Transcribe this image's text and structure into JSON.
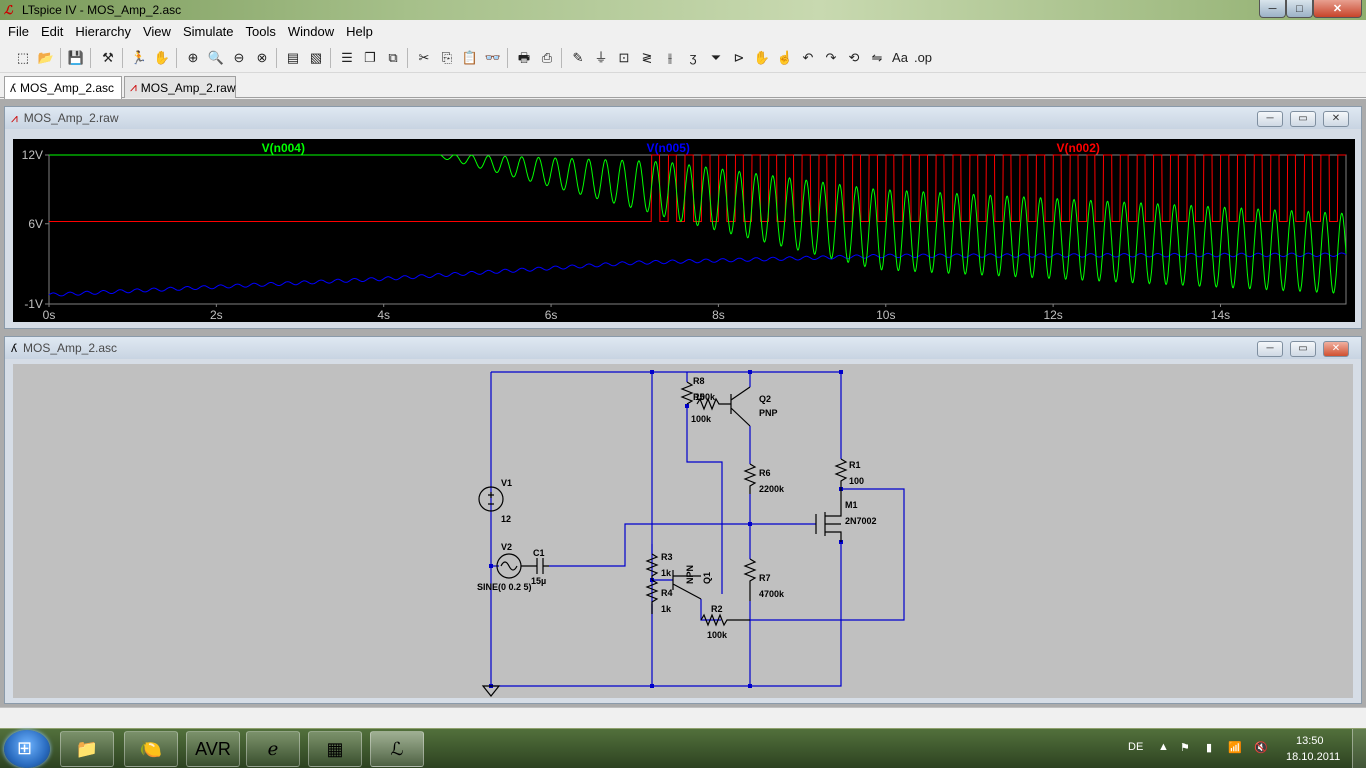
{
  "app": {
    "title": "LTspice IV - MOS_Amp_2.asc"
  },
  "window_buttons": {
    "minimize": "─",
    "maximize": "□",
    "close": "✕"
  },
  "menu": [
    "File",
    "Edit",
    "Hierarchy",
    "View",
    "Simulate",
    "Tools",
    "Window",
    "Help"
  ],
  "toolbar": {
    "icons": [
      "new-schematic-icon",
      "open-icon",
      "save-icon",
      "control-panel-icon",
      "run-icon",
      "halt-icon",
      "zoom-in-icon",
      "zoom-pan-icon",
      "zoom-out-icon",
      "zoom-cancel-icon",
      "autorange-icon",
      "delete-trace-icon",
      "tile-horizontal-icon",
      "cascade-icon",
      "close-all-icon",
      "cut-icon",
      "copy-icon",
      "paste-icon",
      "find-icon",
      "print-preview-icon",
      "print-icon",
      "wire-icon",
      "ground-icon",
      "label-icon",
      "resistor-icon",
      "capacitor-icon",
      "inductor-icon",
      "diode-icon",
      "component-icon",
      "move-icon",
      "drag-icon",
      "undo-icon",
      "redo-icon",
      "rotate-icon",
      "mirror-icon",
      "text-icon",
      "spice-directive-icon"
    ]
  },
  "tabs": [
    {
      "label": "MOS_Amp_2.asc",
      "icon": "schematic-icon",
      "active": true
    },
    {
      "label": "MOS_Amp_2.raw",
      "icon": "waveform-icon",
      "active": false
    }
  ],
  "waveform_window": {
    "title": "MOS_Amp_2.raw"
  },
  "schematic_window": {
    "title": "MOS_Amp_2.asc"
  },
  "chart_data": {
    "type": "line",
    "title": "",
    "xlabel": "",
    "ylabel": "",
    "xlim": [
      0,
      15.5
    ],
    "ylim": [
      -1,
      12
    ],
    "x_ticks": [
      "0s",
      "2s",
      "4s",
      "6s",
      "8s",
      "10s",
      "12s",
      "14s"
    ],
    "y_ticks": [
      "12V",
      "6V",
      "-1V"
    ],
    "grid": false,
    "series": [
      {
        "name": "V(n004)",
        "color": "#00ff00",
        "description_points": [
          [
            0,
            12
          ],
          [
            4.6,
            12
          ],
          [
            7.2,
            9.2
          ],
          [
            9.9,
            5.5
          ],
          [
            15.5,
            3.4
          ]
        ],
        "oscillation_amplitude": [
          [
            4.6,
            0.1
          ],
          [
            7.5,
            2.5
          ],
          [
            9.9,
            3.5
          ],
          [
            15.5,
            3.5
          ]
        ]
      },
      {
        "name": "V(n005)",
        "color": "#0000ff",
        "description_points": [
          [
            0,
            -0.2
          ],
          [
            4,
            1.2
          ],
          [
            7,
            2.6
          ],
          [
            10,
            3.2
          ],
          [
            15.5,
            3.3
          ]
        ]
      },
      {
        "name": "V(n002)",
        "color": "#ff0000",
        "description_points": [
          [
            0,
            6.2
          ],
          [
            7.2,
            6.2
          ],
          [
            15.5,
            6.2
          ]
        ],
        "square_start": 7.2,
        "square_high": 12,
        "square_low": 6.2
      }
    ],
    "frequency_hz": 5
  },
  "schematic": {
    "labels": {
      "R8": "R8",
      "R8v": "100k",
      "R5": "R5",
      "R5v": "100k",
      "Q2": "Q2",
      "Q2t": "PNP",
      "R6": "R6",
      "R6v": "2200k",
      "R1": "R1",
      "R1v": "100",
      "M1": "M1",
      "M1t": "2N7002",
      "V1": "V1",
      "V1v": "12",
      "V2": "V2",
      "V2v": "SINE(0 0.2 5)",
      "C1": "C1",
      "C1v": "15µ",
      "R3": "R3",
      "R3v": "1k",
      "R4": "R4",
      "R4v": "1k",
      "Q1": "Q1",
      "Q1t": "NPN",
      "R7": "R7",
      "R7v": "4700k",
      "R2": "R2",
      "R2v": "100k"
    }
  },
  "taskbar": {
    "apps": [
      "explorer-icon",
      "lemon-app-icon",
      "bascom-avr-icon",
      "internet-explorer-icon",
      "text-editor-icon",
      "ltspice-icon"
    ],
    "language": "DE",
    "time": "13:50",
    "date": "18.10.2011"
  }
}
